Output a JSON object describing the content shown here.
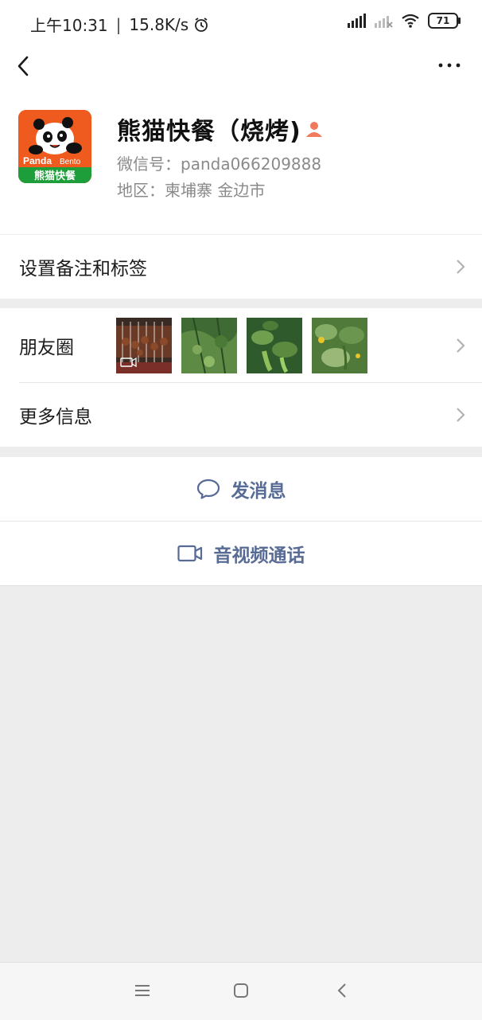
{
  "status_bar": {
    "time": "上午10:31",
    "separator": "|",
    "net_speed": "15.8K/s",
    "battery": "71",
    "icons": [
      "alarm-icon",
      "signal-icon",
      "signal-muted-icon",
      "wifi-icon",
      "battery-icon"
    ]
  },
  "top_bar": {
    "back_icon": "back-arrow-icon",
    "more_icon": "more-dots-icon"
  },
  "profile": {
    "avatar_text_brand": "Panda",
    "avatar_text_bento": "Bento",
    "avatar_text_cn": "熊猫快餐",
    "name": "熊猫快餐（烧烤)",
    "wechat_id": "微信号：panda066209888",
    "region": "地区：柬埔寨  金边市",
    "badge_icon": "contact-person-icon"
  },
  "rows": {
    "remarks_label": "设置备注和标签",
    "moments_label": "朋友圈",
    "more_info_label": "更多信息"
  },
  "actions": {
    "message_label": "发消息",
    "call_label": "音视频通话",
    "message_icon": "chat-bubble-icon",
    "call_icon": "video-call-icon"
  },
  "colors": {
    "link_blue": "#576b95",
    "avatar_orange": "#f05a1f",
    "badge_red": "#f07a5a",
    "background": "#ededed"
  }
}
